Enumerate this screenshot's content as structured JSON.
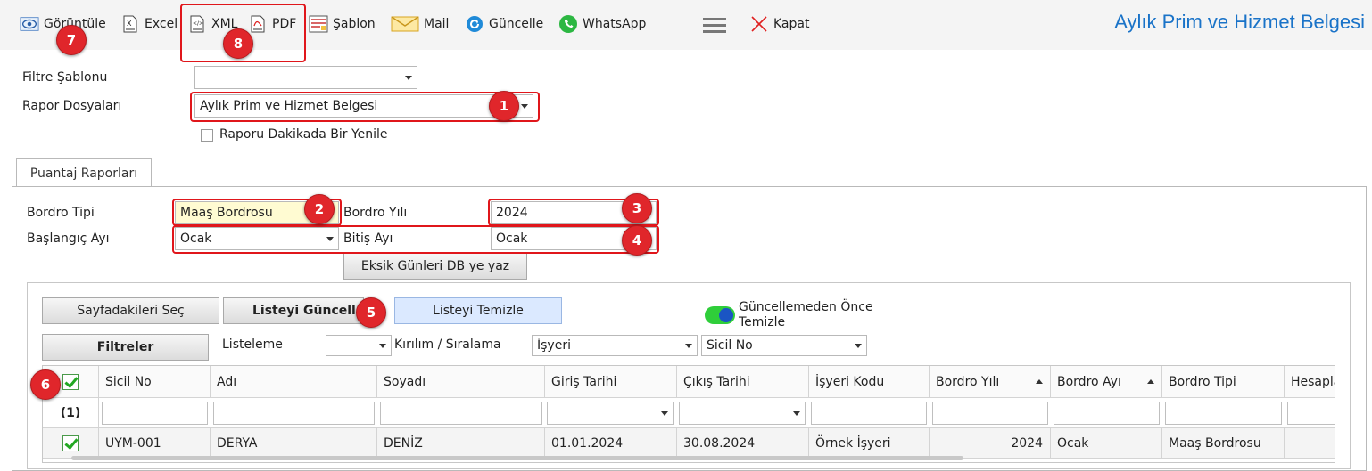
{
  "toolbar": {
    "items": [
      {
        "label": "Görüntüle",
        "icon": "eye-icon"
      },
      {
        "label": "Excel",
        "icon": "excel-icon"
      },
      {
        "label": "XML",
        "icon": "xml-icon"
      },
      {
        "label": "PDF",
        "icon": "pdf-icon"
      },
      {
        "label": "Şablon",
        "icon": "template-icon"
      },
      {
        "label": "Mail",
        "icon": "mail-icon"
      },
      {
        "label": "Güncelle",
        "icon": "refresh-icon"
      },
      {
        "label": "WhatsApp",
        "icon": "whatsapp-icon"
      },
      {
        "label": "Kapat",
        "icon": "close-icon"
      }
    ],
    "title": "Aylık Prim ve Hizmet Belgesi"
  },
  "filters": {
    "filter_template_label": "Filtre Şablonu",
    "filter_template_value": "",
    "report_files_label": "Rapor Dosyaları",
    "report_files_value": "Aylık Prim ve Hizmet Belgesi",
    "refresh_checkbox_label": "Raporu Dakikada Bir Yenile"
  },
  "tab": {
    "label": "Puantaj Raporları"
  },
  "payroll": {
    "type_label": "Bordro Tipi",
    "type_value": "Maaş Bordrosu",
    "year_label": "Bordro Yılı",
    "year_value": "2024",
    "start_month_label": "Başlangıç Ayı",
    "start_month_value": "Ocak",
    "end_month_label": "Bitiş Ayı",
    "end_month_value": "Ocak",
    "write_missing_days_button": "Eksik Günleri DB ye yaz"
  },
  "list_controls": {
    "select_page_button": "Sayfadakileri Seç",
    "update_list_button": "Listeyi Güncelle",
    "clear_list_button": "Listeyi Temizle",
    "clear_before_update_label_line1": "Güncellemeden Önce",
    "clear_before_update_label_line2": "Temizle",
    "filters_button": "Filtreler",
    "listing_label": "Listeleme",
    "listing_value": "",
    "breakdown_label": "Kırılım / Sıralama",
    "breakdown_value_1": "İşyeri",
    "breakdown_value_2": "Sicil No"
  },
  "grid": {
    "columns": [
      "Sicil No",
      "Adı",
      "Soyadı",
      "Giriş Tarihi",
      "Çıkış Tarihi",
      "İşyeri Kodu",
      "Bordro Yılı",
      "Bordro Ayı",
      "Bordro Tipi",
      "Hesapla"
    ],
    "selected_count": "(1)",
    "rows": [
      [
        "UYM-001",
        "DERYA",
        "DENİZ",
        "01.01.2024",
        "30.08.2024",
        "Örnek İşyeri",
        "2024",
        "Ocak",
        "Maaş Bordrosu",
        ""
      ]
    ]
  },
  "annotations": [
    "1",
    "2",
    "3",
    "4",
    "5",
    "6",
    "7",
    "8"
  ],
  "colors": {
    "accent": "#1a73c8",
    "highlight": "#e0161b",
    "badge": "#e0262b",
    "field_yellow": "#fffbd2"
  }
}
